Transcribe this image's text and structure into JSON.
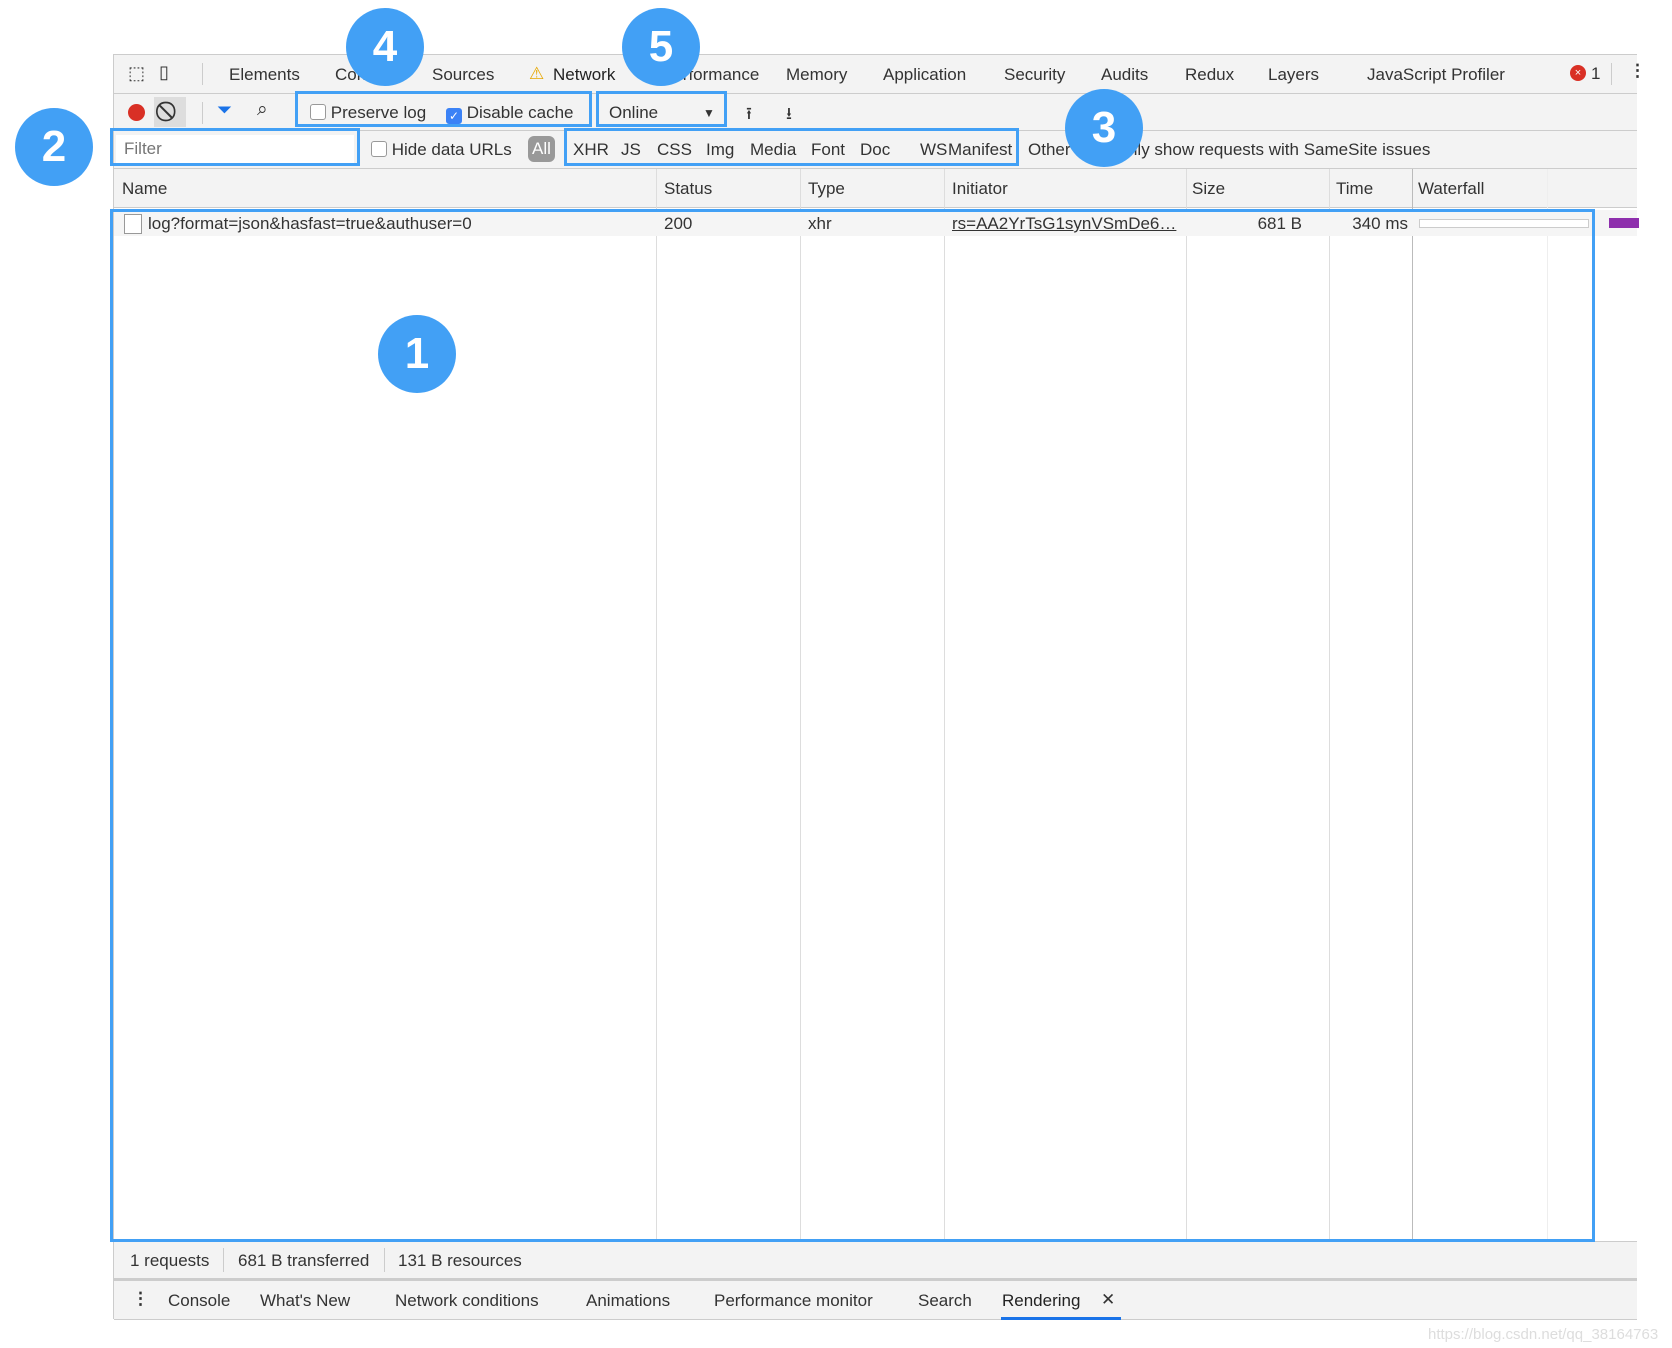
{
  "main_tabs": [
    "Elements",
    "Console",
    "Sources",
    "Network",
    "Performance",
    "Memory",
    "Application",
    "Security",
    "Audits",
    "Redux",
    "Layers",
    "JavaScript Profiler"
  ],
  "error_count": "1",
  "toolbar": {
    "preserve_log": "Preserve log",
    "preserve_log_checked": false,
    "disable_cache": "Disable cache",
    "disable_cache_checked": true,
    "throttle": "Online"
  },
  "filter": {
    "placeholder": "Filter",
    "hide_data_urls": "Hide data URLs",
    "all": "All",
    "types": [
      "XHR",
      "JS",
      "CSS",
      "Img",
      "Media",
      "Font",
      "Doc",
      "WS",
      "Manifest",
      "Other"
    ],
    "samesite": "Only show requests with SameSite issues"
  },
  "columns": [
    "Name",
    "Status",
    "Type",
    "Initiator",
    "Size",
    "Time",
    "Waterfall"
  ],
  "rows": [
    {
      "name": "log?format=json&hasfast=true&authuser=0",
      "status": "200",
      "type": "xhr",
      "initiator": "rs=AA2YrTsG1synVSmDe6…",
      "size": "681 B",
      "time": "340 ms"
    }
  ],
  "status": {
    "requests": "1 requests",
    "transferred": "681 B transferred",
    "resources": "131 B resources"
  },
  "drawer_tabs": [
    "Console",
    "What's New",
    "Network conditions",
    "Animations",
    "Performance monitor",
    "Search",
    "Rendering"
  ],
  "annotations": [
    "1",
    "2",
    "3",
    "4",
    "5"
  ],
  "watermark": "https://blog.csdn.net/qq_38164763",
  "colors": {
    "highlight": "#42a0f5",
    "record": "#d93025",
    "waterfall_bar": "#8e2fad"
  }
}
